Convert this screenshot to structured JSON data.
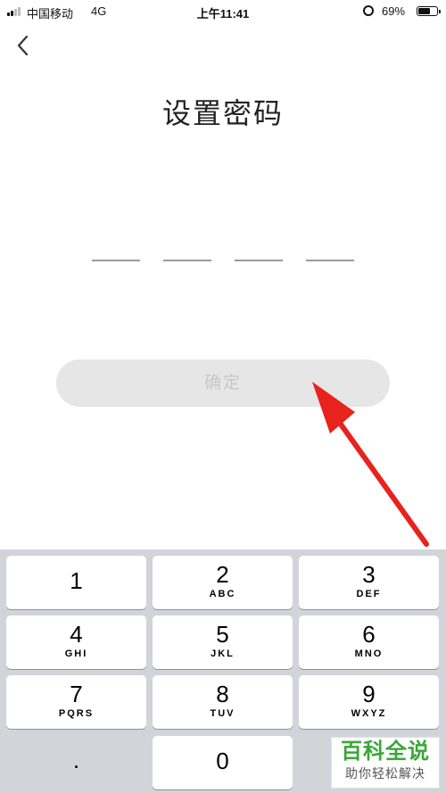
{
  "status_bar": {
    "carrier": "中国移动",
    "network": "4G",
    "time": "上午11:41",
    "alarm_icon": "alarm-clock-icon",
    "battery_percent": "69%",
    "battery_level": 0.69
  },
  "header": {
    "back_icon": "chevron-left-icon"
  },
  "title": "设置密码",
  "pin": {
    "length": 4,
    "entered": 0
  },
  "confirm_button": {
    "label": "确定",
    "enabled": false
  },
  "keypad": {
    "keys": [
      {
        "digit": "1",
        "letters": ""
      },
      {
        "digit": "2",
        "letters": "ABC"
      },
      {
        "digit": "3",
        "letters": "DEF"
      },
      {
        "digit": "4",
        "letters": "GHI"
      },
      {
        "digit": "5",
        "letters": "JKL"
      },
      {
        "digit": "6",
        "letters": "MNO"
      },
      {
        "digit": "7",
        "letters": "PQRS"
      },
      {
        "digit": "8",
        "letters": "TUV"
      },
      {
        "digit": "9",
        "letters": "WXYZ"
      },
      {
        "digit": ".",
        "letters": ""
      },
      {
        "digit": "0",
        "letters": ""
      }
    ]
  },
  "annotation": {
    "arrow_color": "#e8221c"
  },
  "watermark": {
    "line1": "百科全说",
    "line2": "助你轻松解决",
    "color": "#3aa63a"
  }
}
